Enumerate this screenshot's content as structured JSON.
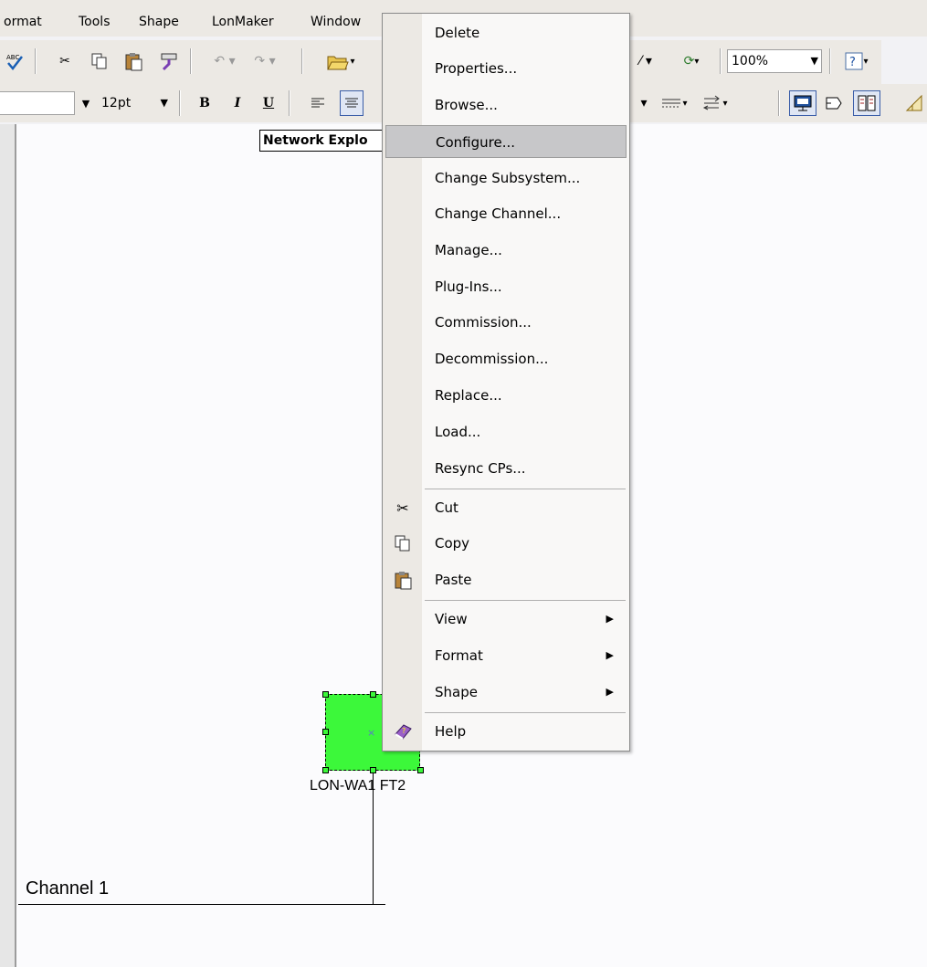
{
  "menubar": {
    "items": [
      "ormat",
      "Tools",
      "Shape",
      "LonMaker",
      "Window"
    ]
  },
  "toolbar": {
    "zoom": "100%",
    "font_size": "12pt",
    "bold": "B",
    "italic": "I",
    "underline": "U"
  },
  "canvas": {
    "network_explorer_label": "Network Explo",
    "node_label": "LON-WA1 FT2",
    "channel_label": "Channel 1"
  },
  "context_menu": {
    "items": [
      {
        "label": "Delete"
      },
      {
        "label": "Properties..."
      },
      {
        "label": "Browse..."
      },
      {
        "label": "Configure...",
        "highlighted": true
      },
      {
        "label": "Change Subsystem..."
      },
      {
        "label": "Change Channel..."
      },
      {
        "label": "Manage..."
      },
      {
        "label": "Plug-Ins..."
      },
      {
        "label": "Commission..."
      },
      {
        "label": "Decommission..."
      },
      {
        "label": "Replace..."
      },
      {
        "label": "Load..."
      },
      {
        "label": "Resync CPs..."
      },
      {
        "label": "Cut",
        "icon": "scissors-icon"
      },
      {
        "label": "Copy",
        "icon": "copy-icon"
      },
      {
        "label": "Paste",
        "icon": "paste-icon"
      },
      {
        "label": "View",
        "submenu": true
      },
      {
        "label": "Format",
        "submenu": true
      },
      {
        "label": "Shape",
        "submenu": true
      },
      {
        "label": "Help",
        "icon": "help-book-icon"
      }
    ]
  },
  "colors": {
    "node_fill": "#3cf83a",
    "menu_highlight": "#c7c7c9",
    "toolbar_bg": "#ece9e4"
  }
}
